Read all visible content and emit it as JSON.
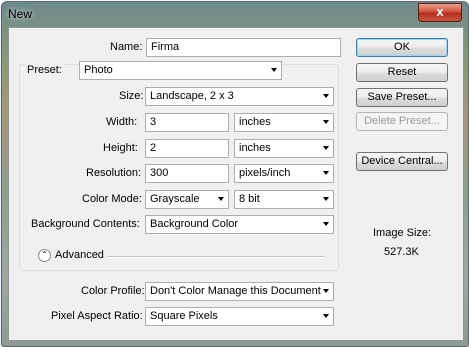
{
  "window": {
    "title": "New",
    "close_glyph": "x"
  },
  "form": {
    "name": {
      "label": "Name:",
      "value": "Firma"
    },
    "preset": {
      "label": "Preset:",
      "value": "Photo"
    },
    "size": {
      "label": "Size:",
      "value": "Landscape, 2 x 3"
    },
    "width": {
      "label": "Width:",
      "value": "3",
      "unit": "inches"
    },
    "height": {
      "label": "Height:",
      "value": "2",
      "unit": "inches"
    },
    "resolution": {
      "label": "Resolution:",
      "value": "300",
      "unit": "pixels/inch"
    },
    "color_mode": {
      "label": "Color Mode:",
      "value": "Grayscale",
      "bits": "8 bit"
    },
    "background": {
      "label": "Background Contents:",
      "value": "Background Color"
    },
    "advanced": {
      "label": "Advanced",
      "icon": "chevron-up-icon"
    },
    "color_profile": {
      "label": "Color Profile:",
      "value": "Don't Color Manage this Document"
    },
    "pixel_aspect": {
      "label": "Pixel Aspect Ratio:",
      "value": "Square Pixels"
    }
  },
  "buttons": {
    "ok": "OK",
    "reset": "Reset",
    "save_preset": "Save Preset...",
    "delete_preset": "Delete Preset...",
    "device_central": "Device Central..."
  },
  "image_size": {
    "label": "Image Size:",
    "value": "527.3K"
  }
}
